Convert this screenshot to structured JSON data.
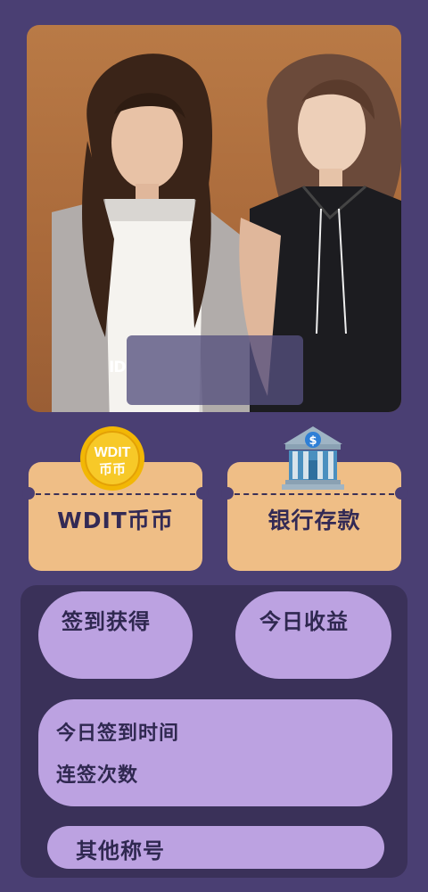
{
  "profile": {
    "id_label": "ID"
  },
  "cards": {
    "coin": {
      "icon_text": "WDIT\n币币",
      "icon_line1": "WDIT",
      "icon_line2": "币币",
      "label": "WDIT币币"
    },
    "bank": {
      "icon_symbol": "$",
      "label": "银行存款"
    }
  },
  "stats": {
    "sign_reward_label": "签到获得",
    "today_income_label": "今日收益",
    "today_sign_time_label": "今日签到时间",
    "streak_label": "连签次数",
    "other_titles_label": "其他称号"
  },
  "colors": {
    "background": "#4a3f73",
    "ticket": "#efbe86",
    "panel": "#3a3159",
    "pill": "#bca2e1",
    "text_dark": "#332a55"
  }
}
